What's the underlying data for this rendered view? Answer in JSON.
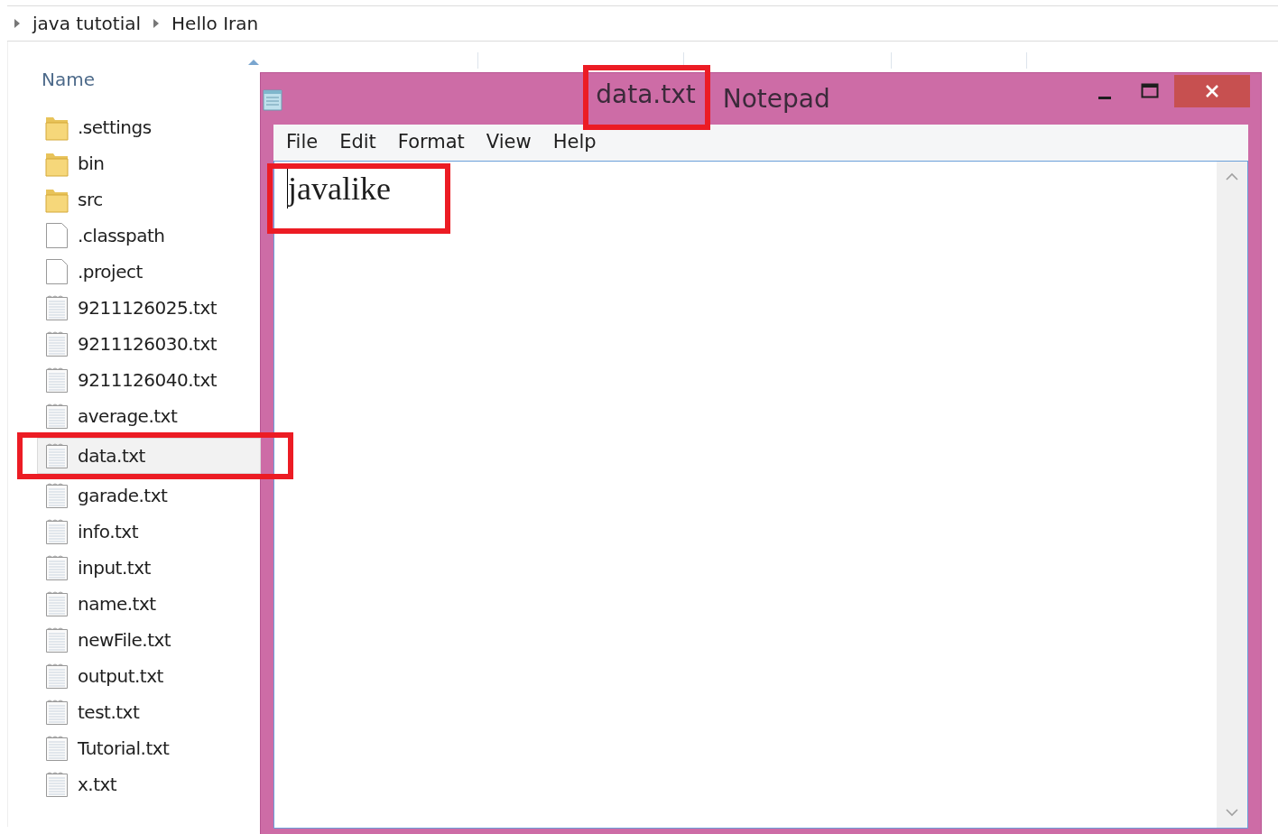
{
  "breadcrumb": [
    {
      "label": "java tutotial"
    },
    {
      "label": "Hello Iran"
    }
  ],
  "explorer": {
    "column_header": "Name",
    "files": [
      {
        "name": ".settings",
        "kind": "folder",
        "selected": false,
        "highlighted": false
      },
      {
        "name": "bin",
        "kind": "folder",
        "selected": false,
        "highlighted": false
      },
      {
        "name": "src",
        "kind": "folder",
        "selected": false,
        "highlighted": false
      },
      {
        "name": ".classpath",
        "kind": "blank",
        "selected": false,
        "highlighted": false
      },
      {
        "name": ".project",
        "kind": "blank",
        "selected": false,
        "highlighted": false
      },
      {
        "name": "9211126025.txt",
        "kind": "text",
        "selected": false,
        "highlighted": false
      },
      {
        "name": "9211126030.txt",
        "kind": "text",
        "selected": false,
        "highlighted": false
      },
      {
        "name": "9211126040.txt",
        "kind": "text",
        "selected": false,
        "highlighted": false
      },
      {
        "name": "average.txt",
        "kind": "text",
        "selected": false,
        "highlighted": false
      },
      {
        "name": "data.txt",
        "kind": "text",
        "selected": true,
        "highlighted": true
      },
      {
        "name": "garade.txt",
        "kind": "text",
        "selected": false,
        "highlighted": false
      },
      {
        "name": "info.txt",
        "kind": "text",
        "selected": false,
        "highlighted": false
      },
      {
        "name": "input.txt",
        "kind": "text",
        "selected": false,
        "highlighted": false
      },
      {
        "name": "name.txt",
        "kind": "text",
        "selected": false,
        "highlighted": false
      },
      {
        "name": "newFile.txt",
        "kind": "text",
        "selected": false,
        "highlighted": false
      },
      {
        "name": "output.txt",
        "kind": "text",
        "selected": false,
        "highlighted": false
      },
      {
        "name": "test.txt",
        "kind": "text",
        "selected": false,
        "highlighted": false
      },
      {
        "name": "Tutorial.txt",
        "kind": "text",
        "selected": false,
        "highlighted": false
      },
      {
        "name": "x.txt",
        "kind": "text",
        "selected": false,
        "highlighted": false
      }
    ]
  },
  "notepad": {
    "title": {
      "text": "data.txt",
      "highlighted": true
    },
    "app_name": "Notepad",
    "menu": [
      "File",
      "Edit",
      "Format",
      "View",
      "Help"
    ],
    "content": {
      "text": "javalike",
      "highlighted": true
    }
  }
}
